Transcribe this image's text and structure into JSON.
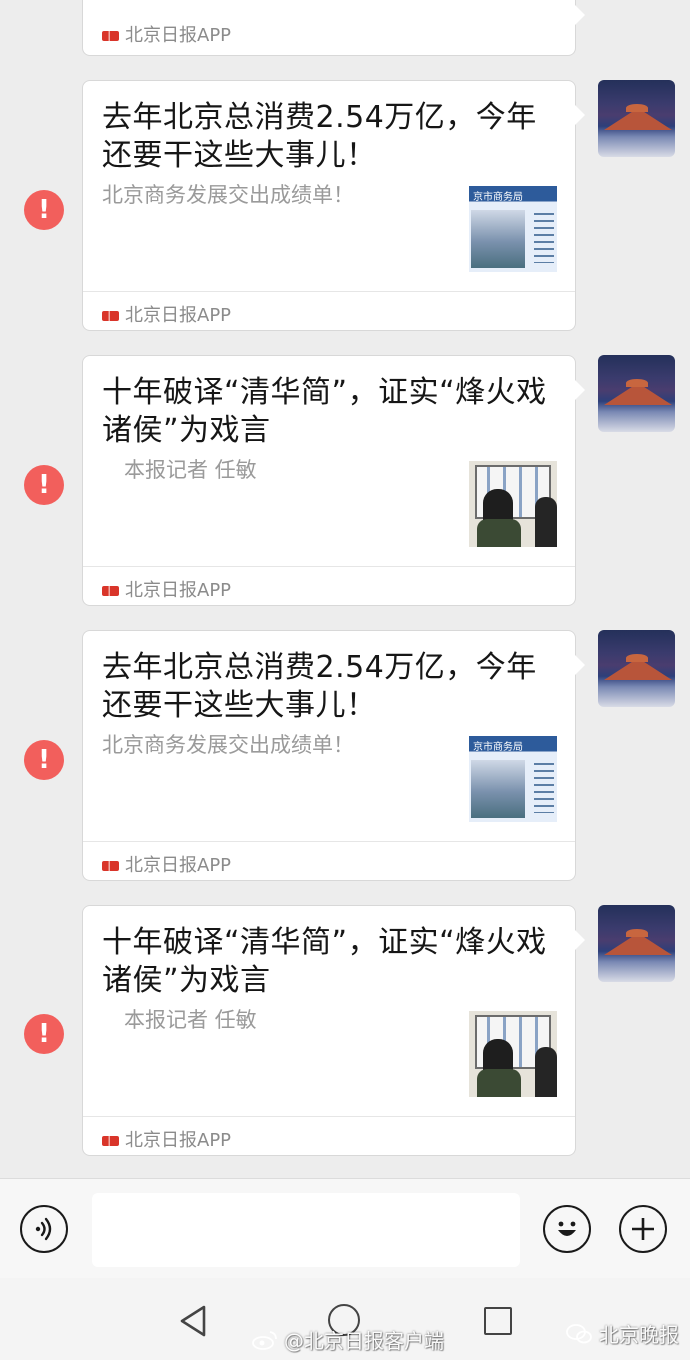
{
  "chat": {
    "partial_card": {
      "source": "北京日报APP"
    },
    "messages": [
      {
        "title": "去年北京总消费2.54万亿，今年还要干这些大事儿！",
        "summary": "北京商务发展交出成绩单！",
        "source": "北京日报APP",
        "thumbnail_icon": "commerce-bureau-thumbnail",
        "status_icon": "exclamation-icon"
      },
      {
        "title": "十年破译“清华简”，证实“烽火戏诸侯”为戏言",
        "summary": "本报记者 任敏",
        "source": "北京日报APP",
        "thumbnail_icon": "museum-visitors-thumbnail",
        "status_icon": "exclamation-icon"
      },
      {
        "title": "去年北京总消费2.54万亿，今年还要干这些大事儿！",
        "summary": "北京商务发展交出成绩单！",
        "source": "北京日报APP",
        "thumbnail_icon": "commerce-bureau-thumbnail",
        "status_icon": "exclamation-icon"
      },
      {
        "title": "十年破译“清华简”，证实“烽火戏诸侯”为戏言",
        "summary": "本报记者 任敏",
        "source": "北京日报APP",
        "thumbnail_icon": "museum-visitors-thumbnail",
        "status_icon": "exclamation-icon"
      }
    ],
    "thumbnail_banner": "京市商务局",
    "error_symbol": "!"
  },
  "input_bar": {
    "text_value": "",
    "voice_icon": "voice-icon",
    "emoji_icon": "emoji-icon",
    "plus_icon": "plus-icon"
  },
  "system_nav": {
    "back_icon": "back-icon",
    "home_icon": "home-icon",
    "recent_icon": "recent-apps-icon"
  },
  "watermarks": {
    "left": "@北京日报客户端",
    "right": "北京晚报"
  },
  "colors": {
    "background": "#ededed",
    "error_badge": "#f25f5c",
    "source_logo": "#d9352a",
    "summary_text": "#9a9a9a"
  }
}
